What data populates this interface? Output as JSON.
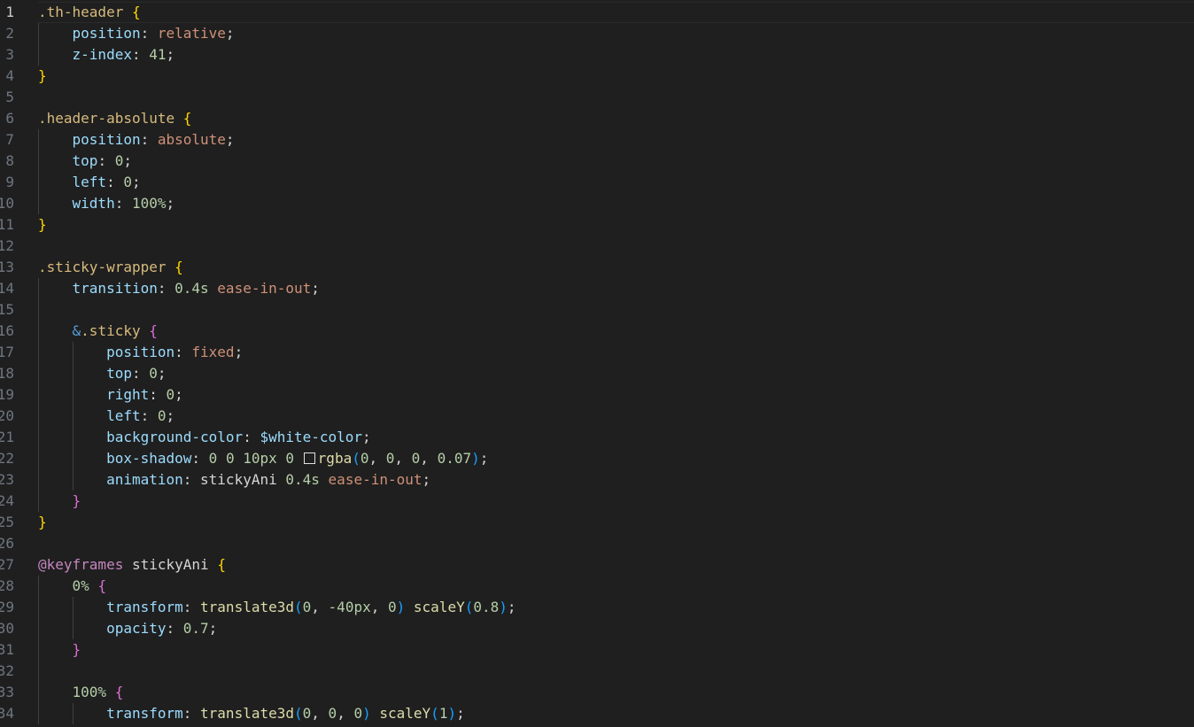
{
  "line_numbers": [
    "1",
    "2",
    "3",
    "4",
    "5",
    "6",
    "7",
    "8",
    "9",
    "10",
    "11",
    "12",
    "13",
    "14",
    "15",
    "16",
    "17",
    "18",
    "19",
    "20",
    "21",
    "22",
    "23",
    "24",
    "25",
    "26",
    "27",
    "28",
    "29",
    "30",
    "31",
    "32",
    "33",
    "34"
  ],
  "code": {
    "l1": {
      "selector": ".th-header",
      "brace": "{"
    },
    "l2": {
      "prop": "position",
      "val": "relative"
    },
    "l3": {
      "prop": "z-index",
      "num": "41"
    },
    "l4": {
      "brace": "}"
    },
    "l6": {
      "selector": ".header-absolute",
      "brace": "{"
    },
    "l7": {
      "prop": "position",
      "val": "absolute"
    },
    "l8": {
      "prop": "top",
      "num": "0"
    },
    "l9": {
      "prop": "left",
      "num": "0"
    },
    "l10": {
      "prop": "width",
      "num": "100%"
    },
    "l11": {
      "brace": "}"
    },
    "l13": {
      "selector": ".sticky-wrapper",
      "brace": "{"
    },
    "l14": {
      "prop": "transition",
      "num": "0.4s",
      "val": "ease-in-out"
    },
    "l16": {
      "amp": "&",
      "selector": ".sticky",
      "brace": "{"
    },
    "l17": {
      "prop": "position",
      "val": "fixed"
    },
    "l18": {
      "prop": "top",
      "num": "0"
    },
    "l19": {
      "prop": "right",
      "num": "0"
    },
    "l20": {
      "prop": "left",
      "num": "0"
    },
    "l21": {
      "prop": "background-color",
      "var": "$white-color"
    },
    "l22": {
      "prop": "box-shadow",
      "num1": "0",
      "num2": "0",
      "num3": "10px",
      "num4": "0",
      "fn": "rgba",
      "a1": "0",
      "a2": "0",
      "a3": "0",
      "a4": "0.07"
    },
    "l23": {
      "prop": "animation",
      "name": "stickyAni",
      "num": "0.4s",
      "val": "ease-in-out"
    },
    "l24": {
      "brace": "}"
    },
    "l25": {
      "brace": "}"
    },
    "l27": {
      "at": "@keyframes",
      "name": "stickyAni",
      "brace": "{"
    },
    "l28": {
      "num": "0%",
      "brace": "{"
    },
    "l29": {
      "prop": "transform",
      "fn1": "translate3d",
      "a1": "0",
      "a2": "-40px",
      "a3": "0",
      "fn2": "scaleY",
      "b1": "0.8"
    },
    "l30": {
      "prop": "opacity",
      "num": "0.7"
    },
    "l31": {
      "brace": "}"
    },
    "l33": {
      "num": "100%",
      "brace": "{"
    },
    "l34": {
      "prop": "transform",
      "fn1": "translate3d",
      "a1": "0",
      "a2": "0",
      "a3": "0",
      "fn2": "scaleY",
      "b1": "1"
    }
  },
  "colors": {
    "background": "#1f1f1f",
    "selector": "#d7ba7d",
    "property": "#9cdcfe",
    "value": "#ce9178",
    "number": "#b5cea8",
    "bracket_level1": "#ffd700",
    "bracket_level2": "#da70d6",
    "bracket_level3": "#179fff",
    "at_rule": "#c586c0",
    "function": "#dcdcaa"
  },
  "icons": {
    "color_swatch": "color-swatch-icon"
  }
}
